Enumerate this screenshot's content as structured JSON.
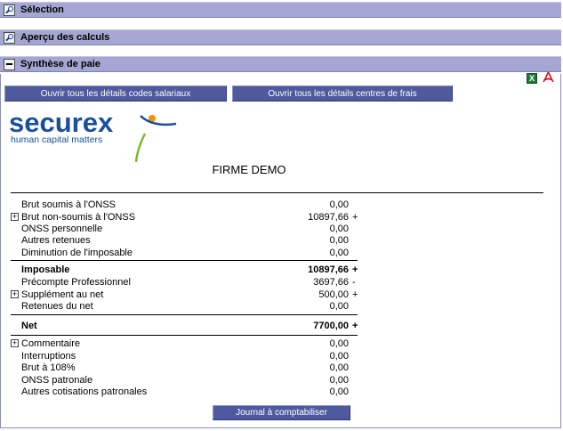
{
  "sections": {
    "selection": "Sélection",
    "apercu": "Aperçu des calculs",
    "synthese": "Synthèse de paie"
  },
  "buttons": {
    "codes_salariaux": "Ouvrir tous les détails codes salariaux",
    "centres_frais": "Ouvrir tous les détails centres de frais",
    "journal": "Journal à comptabiliser"
  },
  "logo": {
    "brand": "securex",
    "tagline": "human capital matters"
  },
  "firm_name": "FIRME DEMO",
  "rows": [
    {
      "label": "Brut soumis à l'ONSS",
      "value": "0,00",
      "sign": "",
      "expandable": false,
      "bold": false
    },
    {
      "label": "Brut non-soumis à l'ONSS",
      "value": "10897,66",
      "sign": "+",
      "expandable": true,
      "bold": false
    },
    {
      "label": "ONSS personnelle",
      "value": "0,00",
      "sign": "",
      "expandable": false,
      "bold": false
    },
    {
      "label": "Autres retenues",
      "value": "0,00",
      "sign": "",
      "expandable": false,
      "bold": false
    },
    {
      "label": "Diminution de l'imposable",
      "value": "0,00",
      "sign": "",
      "expandable": false,
      "bold": false
    },
    {
      "label": "Imposable",
      "value": "10897,66",
      "sign": "+",
      "expandable": false,
      "bold": true
    },
    {
      "label": "Précompte Professionnel",
      "value": "3697,66",
      "sign": "-",
      "expandable": false,
      "bold": false
    },
    {
      "label": "Supplément au net",
      "value": "500,00",
      "sign": "+",
      "expandable": true,
      "bold": false
    },
    {
      "label": "Retenues du net",
      "value": "0,00",
      "sign": "",
      "expandable": false,
      "bold": false
    },
    {
      "label": "Net",
      "value": "7700,00",
      "sign": "+",
      "expandable": false,
      "bold": true
    },
    {
      "label": "Commentaire",
      "value": "0,00",
      "sign": "",
      "expandable": true,
      "bold": false
    },
    {
      "label": "Interruptions",
      "value": "0,00",
      "sign": "",
      "expandable": false,
      "bold": false
    },
    {
      "label": "Brut à 108%",
      "value": "0,00",
      "sign": "",
      "expandable": false,
      "bold": false
    },
    {
      "label": "ONSS patronale",
      "value": "0,00",
      "sign": "",
      "expandable": false,
      "bold": false
    },
    {
      "label": "Autres cotisations patronales",
      "value": "0,00",
      "sign": "",
      "expandable": false,
      "bold": false
    }
  ],
  "colors": {
    "header_bg": "#a3a7d1",
    "button_bg": "#4f5a9e",
    "logo_blue": "#1a4f9c",
    "logo_orange": "#f39200",
    "logo_green": "#7ab929"
  }
}
